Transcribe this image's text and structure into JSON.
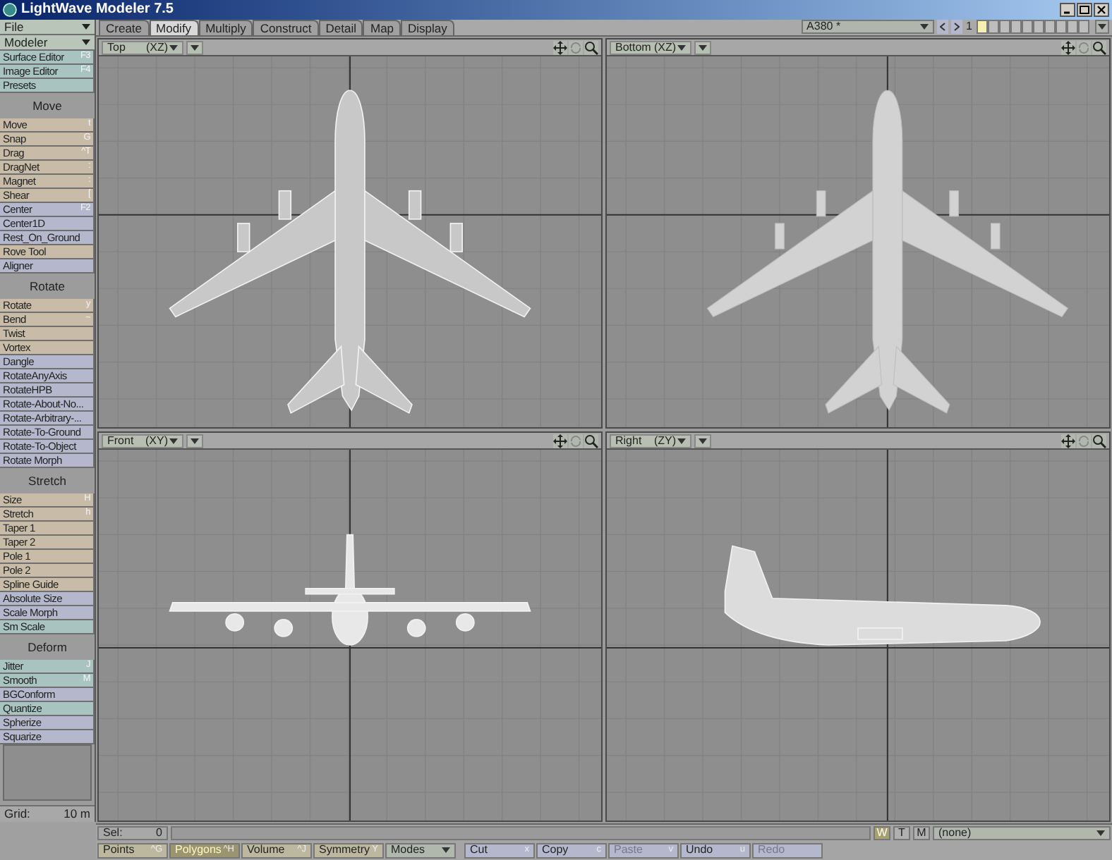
{
  "window": {
    "title": "LightWave Modeler 7.5"
  },
  "tabs": [
    {
      "label": "Create",
      "selected": false
    },
    {
      "label": "Modify",
      "selected": true
    },
    {
      "label": "Multiply",
      "selected": false
    },
    {
      "label": "Construct",
      "selected": false
    },
    {
      "label": "Detail",
      "selected": false
    },
    {
      "label": "Map",
      "selected": false
    },
    {
      "label": "Display",
      "selected": false
    }
  ],
  "object_selector": {
    "value": "A380 *",
    "layer": "1",
    "layers": [
      {
        "selected": true
      },
      {
        "selected": false
      },
      {
        "selected": false
      },
      {
        "selected": false
      },
      {
        "selected": false
      },
      {
        "selected": false
      },
      {
        "selected": false
      },
      {
        "selected": false
      },
      {
        "selected": false
      },
      {
        "selected": false
      }
    ]
  },
  "sidebar": {
    "menus": [
      {
        "label": "File"
      },
      {
        "label": "Modeler"
      }
    ],
    "top_items": [
      {
        "label": "Surface Editor",
        "key": "F3",
        "color": "#a9c4c0"
      },
      {
        "label": "Image Editor",
        "key": "F4",
        "color": "#a9c4c0"
      },
      {
        "label": "Presets",
        "color": "#a9c4c0"
      }
    ],
    "groups": [
      {
        "title": "Move",
        "items": [
          {
            "label": "Move",
            "key": "t",
            "color": "#c8bca8"
          },
          {
            "label": "Snap",
            "key": "G",
            "color": "#c8bca8"
          },
          {
            "label": "Drag",
            "key": "^T",
            "color": "#c8bca8"
          },
          {
            "label": "DragNet",
            "key": ":",
            "color": "#c8bca8"
          },
          {
            "label": "Magnet",
            "key": ":",
            "color": "#c8bca8"
          },
          {
            "label": "Shear",
            "key": "[",
            "color": "#c8bca8"
          },
          {
            "label": "Center",
            "key": "F2",
            "color": "#b5b8cc"
          },
          {
            "label": "Center1D",
            "color": "#b5b8cc"
          },
          {
            "label": "Rest_On_Ground",
            "color": "#b5b8cc"
          },
          {
            "label": "Rove Tool",
            "color": "#c8bca8"
          },
          {
            "label": "Aligner",
            "color": "#b5b8cc"
          }
        ]
      },
      {
        "title": "Rotate",
        "items": [
          {
            "label": "Rotate",
            "key": "y",
            "color": "#c8bca8"
          },
          {
            "label": "Bend",
            "key": "~",
            "color": "#c8bca8"
          },
          {
            "label": "Twist",
            "color": "#c8bca8"
          },
          {
            "label": "Vortex",
            "color": "#c8bca8"
          },
          {
            "label": "Dangle",
            "color": "#b5b8cc"
          },
          {
            "label": "RotateAnyAxis",
            "color": "#b5b8cc"
          },
          {
            "label": "RotateHPB",
            "color": "#b5b8cc"
          },
          {
            "label": "Rotate-About-No...",
            "color": "#b5b8cc"
          },
          {
            "label": "Rotate-Arbitrary-...",
            "color": "#b5b8cc"
          },
          {
            "label": "Rotate-To-Ground",
            "color": "#b5b8cc"
          },
          {
            "label": "Rotate-To-Object",
            "color": "#b5b8cc"
          },
          {
            "label": "Rotate Morph",
            "color": "#b5b8cc"
          }
        ]
      },
      {
        "title": "Stretch",
        "items": [
          {
            "label": "Size",
            "key": "H",
            "color": "#c8bca8"
          },
          {
            "label": "Stretch",
            "key": "h",
            "color": "#c8bca8"
          },
          {
            "label": "Taper 1",
            "color": "#c8bca8"
          },
          {
            "label": "Taper 2",
            "color": "#c8bca8"
          },
          {
            "label": "Pole 1",
            "color": "#c8bca8"
          },
          {
            "label": "Pole 2",
            "color": "#c8bca8"
          },
          {
            "label": "Spline Guide",
            "color": "#c8bca8"
          },
          {
            "label": "Absolute Size",
            "color": "#b5b8cc"
          },
          {
            "label": "Scale Morph",
            "color": "#b5b8cc"
          },
          {
            "label": "Sm Scale",
            "color": "#a9c4c0"
          }
        ]
      },
      {
        "title": "Deform",
        "items": [
          {
            "label": "Jitter",
            "key": "J",
            "color": "#a9c4c0"
          },
          {
            "label": "Smooth",
            "key": "M",
            "color": "#a9c4c0"
          },
          {
            "label": "BGConform",
            "color": "#b5b8cc"
          },
          {
            "label": "Quantize",
            "color": "#a9c4c0"
          },
          {
            "label": "Spherize",
            "color": "#b5b8cc"
          },
          {
            "label": "Squarize",
            "color": "#b5b8cc"
          }
        ]
      }
    ],
    "grid": {
      "label": "Grid:",
      "value": "10 m"
    }
  },
  "viewports": [
    {
      "view": "Top",
      "kind": "top",
      "axes": "(XZ)"
    },
    {
      "view": "Bottom",
      "kind": "bottom",
      "axes": "(XZ)"
    },
    {
      "view": "Front",
      "kind": "front",
      "axes": "(XY)"
    },
    {
      "view": "Right",
      "kind": "right",
      "axes": "(ZY)"
    }
  ],
  "selection_bar": {
    "label": "Sel:",
    "count": "0",
    "wtm": [
      {
        "label": "W",
        "selected": true
      },
      {
        "label": "T",
        "selected": false
      },
      {
        "label": "M",
        "selected": false
      }
    ],
    "morph": "(none)"
  },
  "bottom_toolbar": {
    "modes": [
      {
        "label": "Points",
        "key": "^G",
        "selected": false
      },
      {
        "label": "Polygons",
        "key": "^H",
        "selected": true
      },
      {
        "label": "Volume",
        "key": "^J",
        "selected": false
      }
    ],
    "symmetry": {
      "label": "Symmetry",
      "key": "Y"
    },
    "modes_menu": "Modes",
    "edit": [
      {
        "label": "Cut",
        "key": "x",
        "disabled": false
      },
      {
        "label": "Copy",
        "key": "c",
        "disabled": false
      },
      {
        "label": "Paste",
        "key": "v",
        "disabled": true
      },
      {
        "label": "Undo",
        "key": "u",
        "disabled": false
      },
      {
        "label": "Redo",
        "disabled": true
      }
    ]
  }
}
